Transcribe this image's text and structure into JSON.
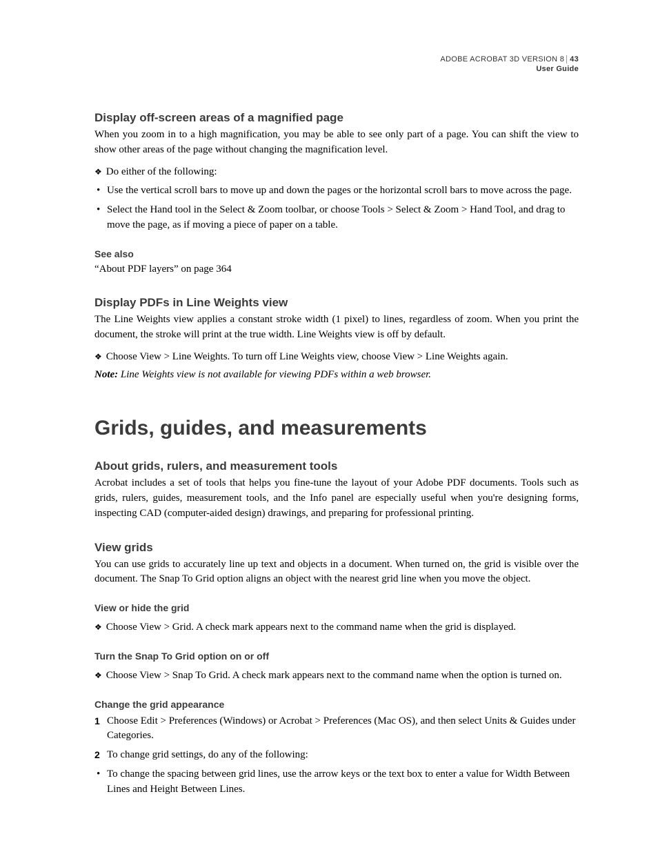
{
  "header": {
    "product": "ADOBE ACROBAT 3D VERSION 8",
    "pagenum": "43",
    "subtitle": "User Guide"
  },
  "s1": {
    "title": "Display off-screen areas of a magnified page",
    "p1": "When you zoom in to a high magnification, you may be able to see only part of a page. You can shift the view to show other areas of the page without changing the magnification level.",
    "diamond": "Do either of the following:",
    "b1": "Use the vertical scroll bars to move up and down the pages or the horizontal scroll bars to move across the page.",
    "b2": "Select the Hand tool in the Select & Zoom toolbar, or choose Tools > Select & Zoom > Hand Tool, and drag to move the page, as if moving a piece of paper on a table."
  },
  "seealso": {
    "title": "See also",
    "p1": "“About PDF layers” on page 364"
  },
  "s2": {
    "title": "Display PDFs in Line Weights view",
    "p1": "The Line Weights view applies a constant stroke width (1 pixel) to lines, regardless of zoom. When you print the document, the stroke will print at the true width. Line Weights view is off by default.",
    "diamond": "Choose View > Line Weights. To turn off Line Weights view, choose View > Line Weights again.",
    "note_label": "Note:",
    "note_body": " Line Weights view is not available for viewing PDFs within a web browser."
  },
  "chapter": "Grids, guides, and measurements",
  "s3": {
    "title": "About grids, rulers, and measurement tools",
    "p1": "Acrobat includes a set of tools that helps you fine-tune the layout of your Adobe PDF documents. Tools such as grids, rulers, guides, measurement tools, and the Info panel are especially useful when you're designing forms, inspecting CAD (computer-aided design) drawings, and preparing for professional printing."
  },
  "s4": {
    "title": "View grids",
    "p1": "You can use grids to accurately line up text and objects in a document. When turned on, the grid is visible over the document. The Snap To Grid option aligns an object with the nearest grid line when you move the object.",
    "sub1_title": "View or hide the grid",
    "sub1_diamond": "Choose View > Grid. A check mark appears next to the command name when the grid is displayed.",
    "sub2_title": "Turn the Snap To Grid option on or off",
    "sub2_diamond": "Choose View > Snap To Grid. A check mark appears next to the command name when the option is turned on.",
    "sub3_title": "Change the grid appearance",
    "step1_num": "1",
    "step1": "Choose Edit > Preferences (Windows) or Acrobat > Preferences (Mac OS), and then select Units & Guides under Categories.",
    "step2_num": "2",
    "step2": "To change grid settings, do any of the following:",
    "b1": "To change the spacing between grid lines, use the arrow keys or the text box to enter a value for Width Between Lines and Height Between Lines."
  }
}
